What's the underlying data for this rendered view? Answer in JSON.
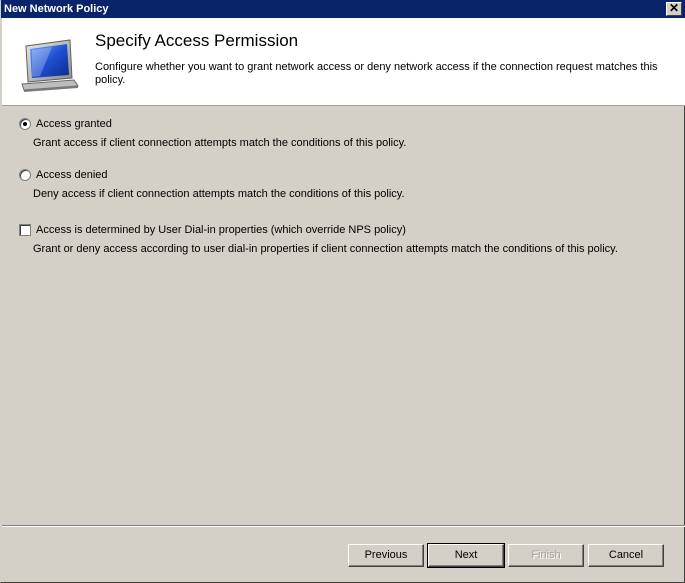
{
  "window": {
    "title": "New Network Policy",
    "close_glyph": "✕"
  },
  "header": {
    "title": "Specify Access Permission",
    "description": "Configure whether you want to grant network access or deny network access if the connection request matches this policy.",
    "icon": "computer-monitor-icon"
  },
  "options": {
    "granted": {
      "label": "Access granted",
      "description": "Grant access if client connection attempts match the conditions of this policy.",
      "selected": true
    },
    "denied": {
      "label": "Access denied",
      "description": "Deny access if client connection attempts match the conditions of this policy.",
      "selected": false
    },
    "dialin": {
      "label": "Access is determined by User Dial-in properties (which override NPS policy)",
      "description": "Grant or deny access according to user dial-in properties if client connection attempts match the conditions of this policy.",
      "checked": false
    }
  },
  "buttons": {
    "previous": "Previous",
    "next": "Next",
    "finish": "Finish",
    "cancel": "Cancel"
  },
  "colors": {
    "titlebar": "#0a246a",
    "dialog_bg": "#d4d0c8",
    "header_bg": "#ffffff"
  }
}
